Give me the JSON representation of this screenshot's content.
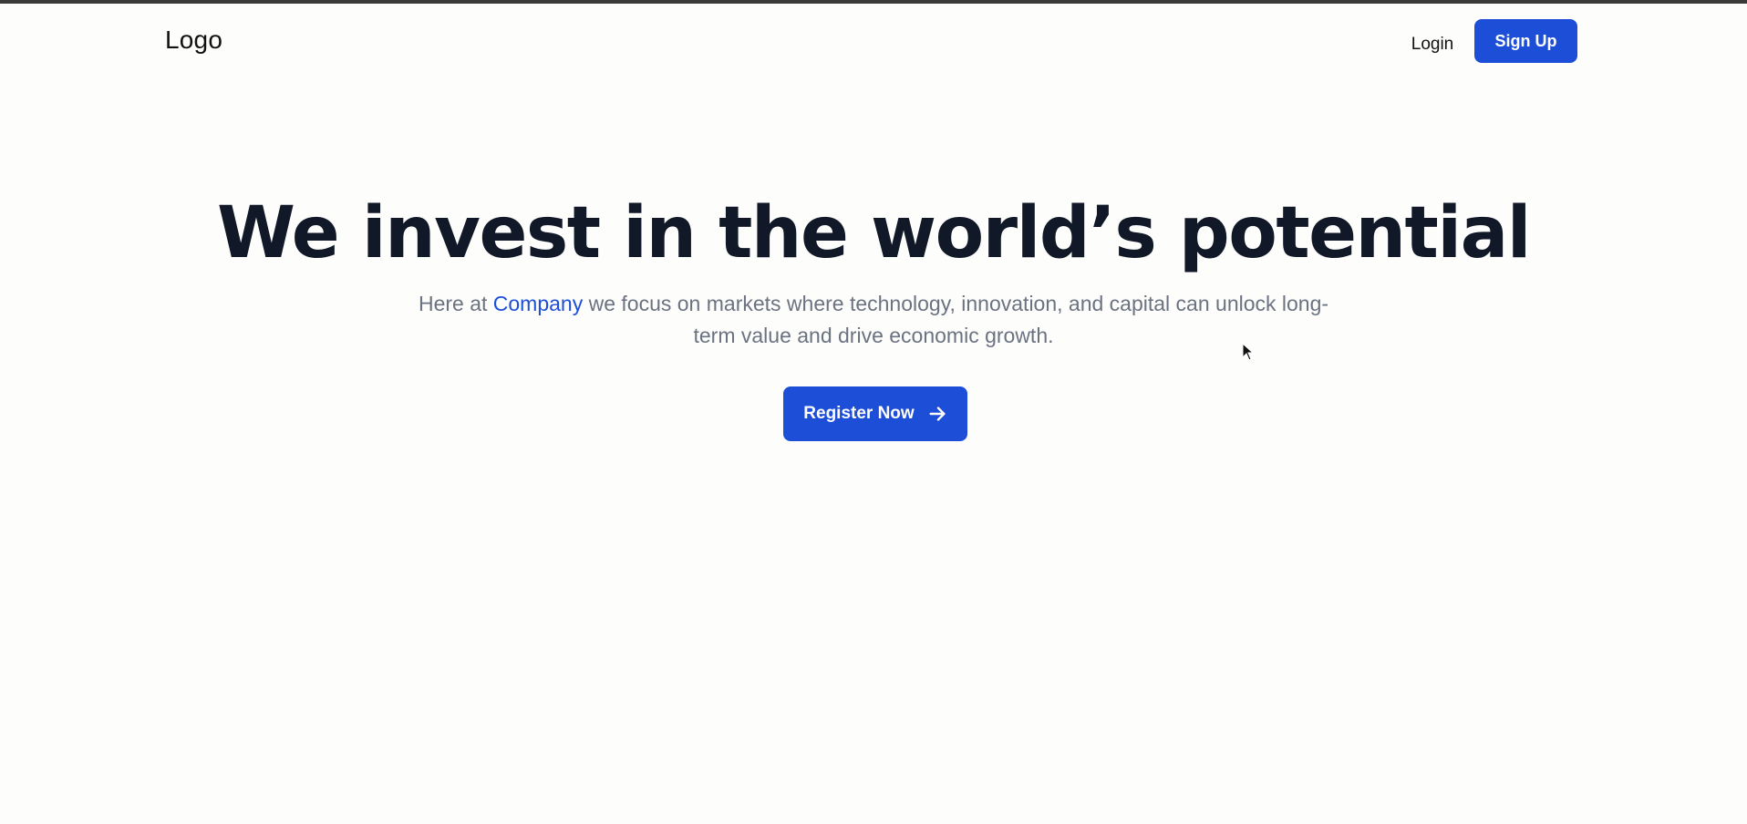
{
  "header": {
    "logo": "Logo",
    "login_label": "Login",
    "signup_label": "Sign Up"
  },
  "hero": {
    "title": "We invest in the world’s potential",
    "subtitle_prefix": "Here at ",
    "subtitle_accent": "Company",
    "subtitle_suffix": " we focus on markets where technology, innovation, and capital can unlock long-term value and drive economic growth.",
    "cta_label": "Register Now",
    "cta_icon": "arrow-right-icon"
  },
  "colors": {
    "accent": "#1d4ed8",
    "title": "#111827",
    "muted": "#6b7280",
    "background": "#fdfdfc"
  }
}
